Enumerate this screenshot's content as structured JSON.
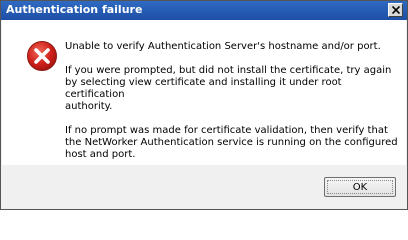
{
  "dialog": {
    "title": "Authentication failure",
    "close_symbol": "X",
    "icon": "error-icon",
    "messages": [
      "Unable to verify Authentication Server's hostname and/or port.",
      "If you were prompted, but did not install the certificate, try again\nby selecting view certificate and installing it under root certification\nauthority.",
      "If no prompt was made for certificate validation, then verify that\nthe NetWorker Authentication service is running on the configured\nhost and port."
    ],
    "ok_label": "OK"
  },
  "colors": {
    "titlebar": "#1e4fa6",
    "error_red": "#d0201a",
    "dialog_bg": "#f0f0f0"
  }
}
